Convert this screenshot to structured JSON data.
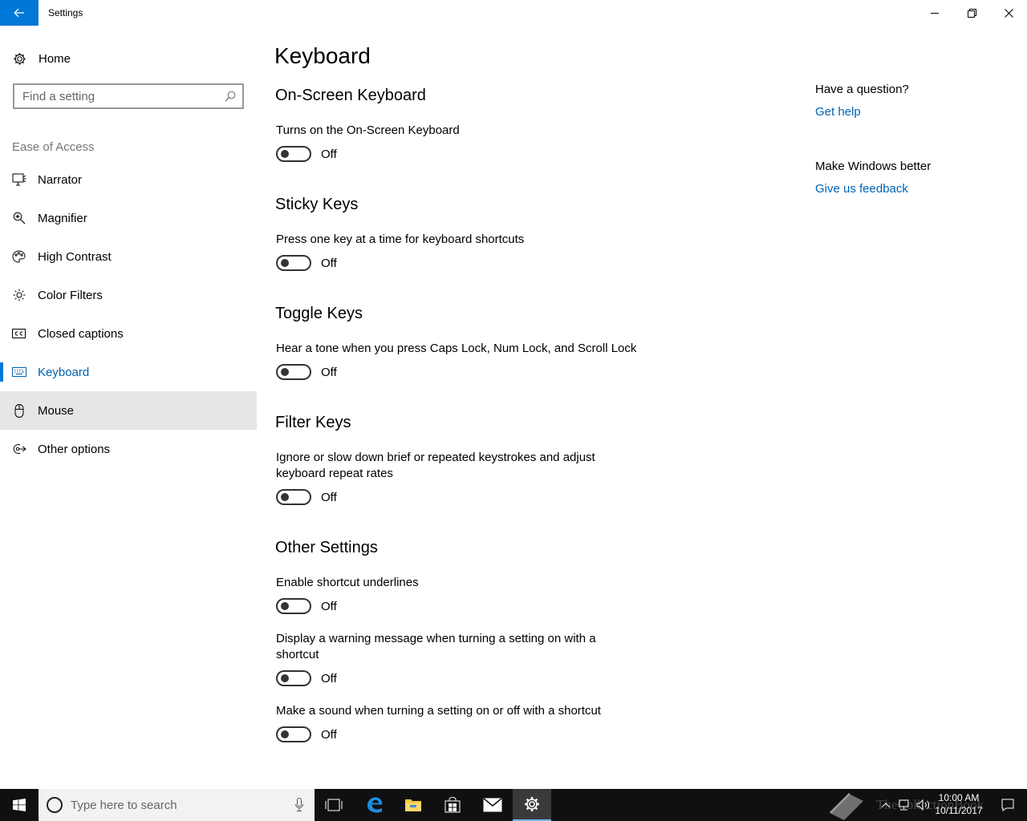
{
  "window": {
    "title": "Settings",
    "back_icon": "back-arrow-icon"
  },
  "sidebar": {
    "home_label": "Home",
    "search_placeholder": "Find a setting",
    "section_label": "Ease of Access",
    "items": [
      {
        "label": "Narrator",
        "icon": "narrator-icon"
      },
      {
        "label": "Magnifier",
        "icon": "magnifier-icon"
      },
      {
        "label": "High Contrast",
        "icon": "high-contrast-icon"
      },
      {
        "label": "Color Filters",
        "icon": "color-filters-icon"
      },
      {
        "label": "Closed captions",
        "icon": "closed-captions-icon"
      },
      {
        "label": "Keyboard",
        "icon": "keyboard-icon",
        "selected": true
      },
      {
        "label": "Mouse",
        "icon": "mouse-icon",
        "hovered": true
      },
      {
        "label": "Other options",
        "icon": "other-options-icon"
      }
    ]
  },
  "main": {
    "title": "Keyboard",
    "on_screen_keyboard": {
      "title": "On-Screen Keyboard",
      "desc": "Turns on the On-Screen Keyboard",
      "state": "Off"
    },
    "sticky_keys": {
      "title": "Sticky Keys",
      "desc": "Press one key at a time for keyboard shortcuts",
      "state": "Off"
    },
    "toggle_keys": {
      "title": "Toggle Keys",
      "desc": "Hear a tone when you press Caps Lock, Num Lock, and Scroll Lock",
      "state": "Off"
    },
    "filter_keys": {
      "title": "Filter Keys",
      "desc": "Ignore or slow down brief or repeated keystrokes and adjust keyboard repeat rates",
      "state": "Off"
    },
    "other_settings": {
      "title": "Other Settings",
      "shortcut_underlines": {
        "desc": "Enable shortcut underlines",
        "state": "Off"
      },
      "warning_message": {
        "desc": "Display a warning message when turning a setting on with a shortcut",
        "state": "Off"
      },
      "make_sound": {
        "desc": "Make a sound when turning a setting on or off with a shortcut",
        "state": "Off"
      }
    }
  },
  "aside": {
    "question_heading": "Have a question?",
    "get_help": "Get help",
    "better_heading": "Make Windows better",
    "feedback": "Give us feedback"
  },
  "taskbar": {
    "search_placeholder": "Type here to search",
    "pinned": [
      "task-view-icon",
      "edge-icon",
      "file-explorer-icon",
      "store-icon",
      "mail-icon",
      "settings-icon"
    ],
    "clock_time": "10:00 AM",
    "clock_date": "10/11/2017",
    "watermark": "TheCollectionBook"
  },
  "colors": {
    "accent": "#0078d7",
    "link": "#0063b1",
    "taskbar": "#101010",
    "hover": "#e6e6e6"
  }
}
